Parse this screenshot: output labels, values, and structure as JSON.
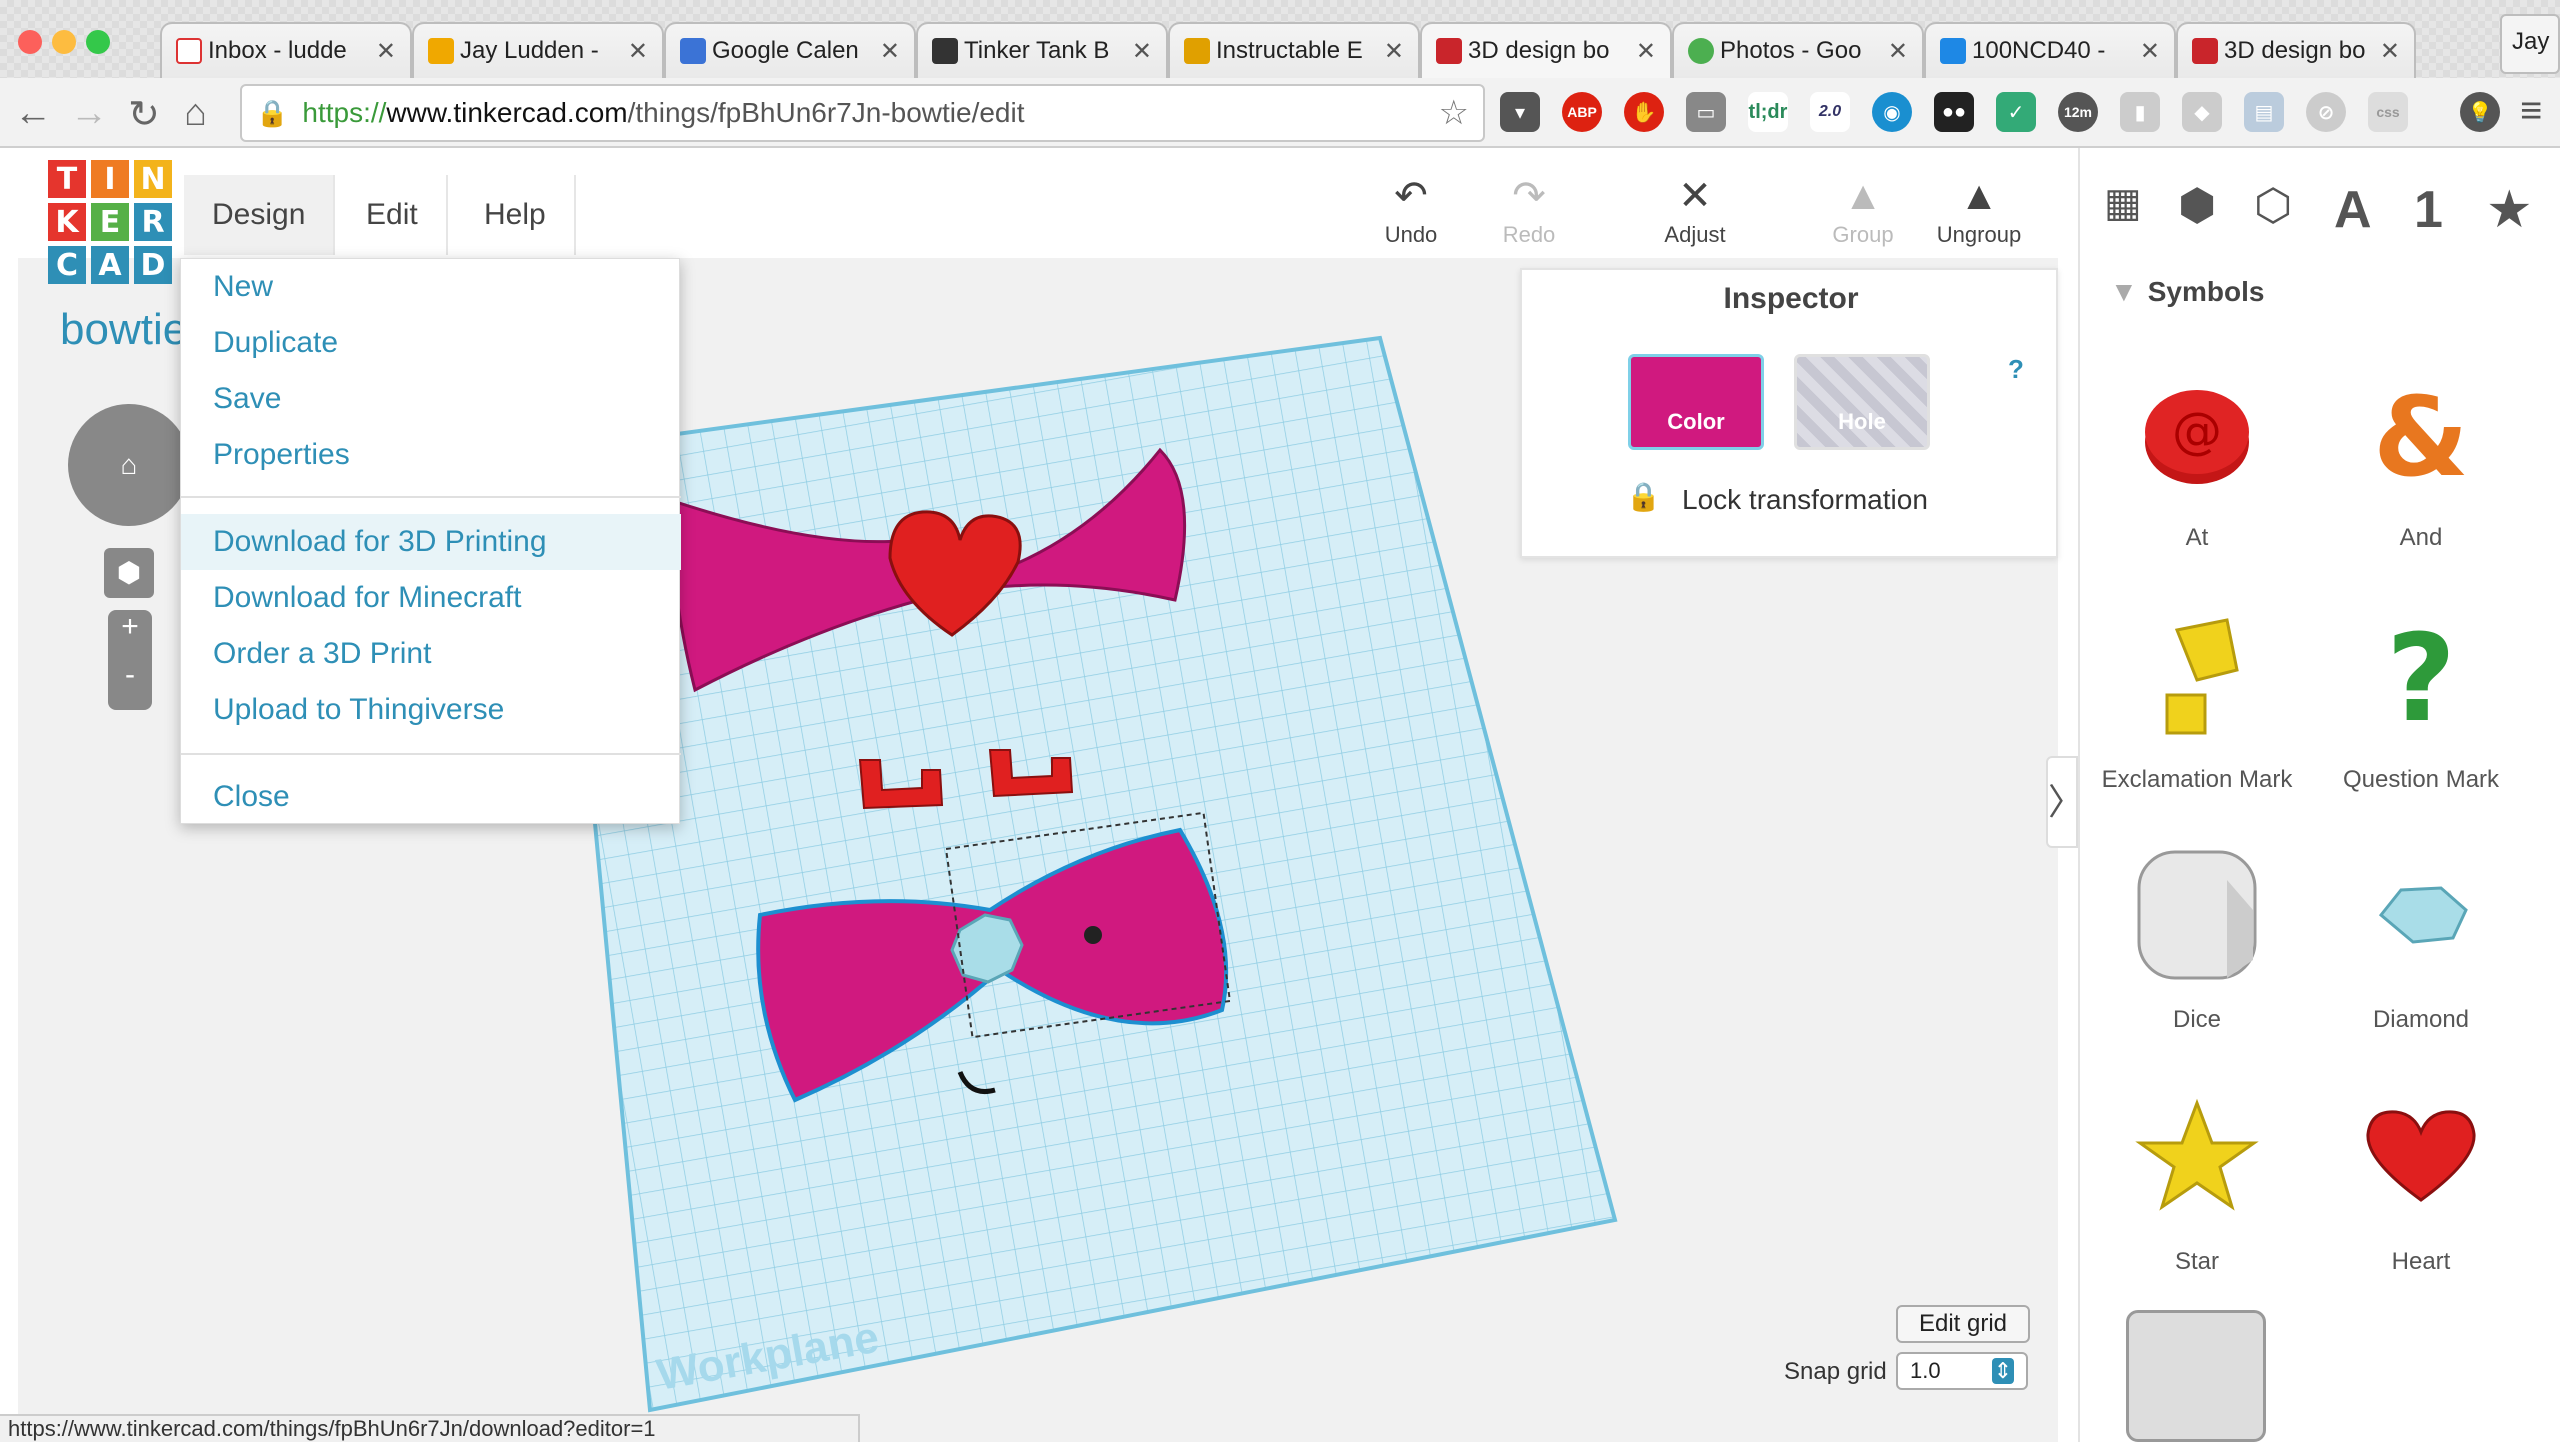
{
  "browser": {
    "tabs": [
      {
        "title": "Inbox - ludde",
        "color": "#d33"
      },
      {
        "title": "Jay Ludden -",
        "color": "#f0a800"
      },
      {
        "title": "Google Calen",
        "color": "#3b73d6"
      },
      {
        "title": "Tinker Tank B",
        "color": "#333"
      },
      {
        "title": "Instructable E",
        "color": "#e0a000"
      },
      {
        "title": "3D design bo",
        "color": "#c9252b"
      },
      {
        "title": "Photos - Goo",
        "color": "#4caf50"
      },
      {
        "title": "100NCD40 -",
        "color": "#1e88e5"
      },
      {
        "title": "3D design bo",
        "color": "#c9252b"
      }
    ],
    "profile": "Jay",
    "url_scheme": "https://",
    "url_host": "www.tinkercad.com",
    "url_path": "/things/fpBhUn6r7Jn-bowtie/edit",
    "status_url": "https://www.tinkercad.com/things/fpBhUn6r7Jn/download?editor=1",
    "extensions": [
      "ABP",
      "tl;dr",
      "2.0",
      "12m"
    ]
  },
  "app": {
    "logo_letters": [
      "T",
      "I",
      "N",
      "K",
      "E",
      "R",
      "C",
      "A",
      "D"
    ],
    "menus": [
      "Design",
      "Edit",
      "Help"
    ],
    "design_title": "bowtie",
    "dropdown": {
      "group1": [
        "New",
        "Duplicate",
        "Save",
        "Properties"
      ],
      "group2": [
        "Download for 3D Printing",
        "Download for Minecraft",
        "Order a 3D Print",
        "Upload to Thingiverse"
      ],
      "group3": [
        "Close"
      ]
    },
    "toolbar": {
      "undo": "Undo",
      "redo": "Redo",
      "adjust": "Adjust",
      "group": "Group",
      "ungroup": "Ungroup"
    },
    "inspector": {
      "title": "Inspector",
      "color_label": "Color",
      "hole_label": "Hole",
      "help": "?",
      "lock_label": "Lock transformation"
    },
    "workplane_label": "Workplane",
    "edit_grid": "Edit grid",
    "snap_label": "Snap grid",
    "snap_value": "1.0",
    "panel": {
      "tabs": [
        "A",
        "1"
      ],
      "category": "Symbols",
      "shapes": [
        "At",
        "And",
        "Exclamation Mark",
        "Question Mark",
        "Dice",
        "Diamond",
        "Star",
        "Heart"
      ]
    },
    "colors": {
      "accent": "#2e8fb6",
      "magenta": "#d0197f",
      "shape_red": "#e02020"
    }
  }
}
